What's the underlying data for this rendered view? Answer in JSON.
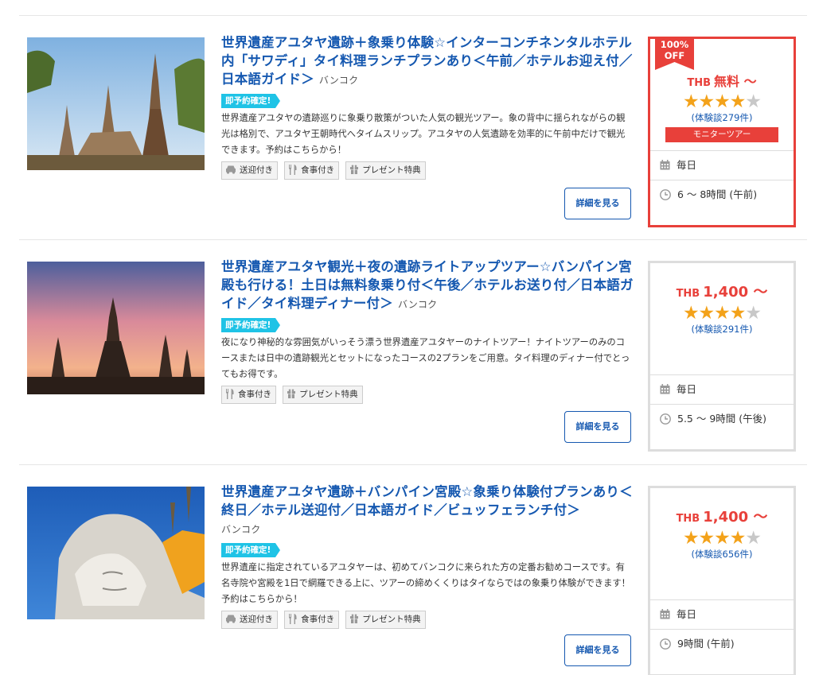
{
  "ui": {
    "detail_button_label": "詳細を見る"
  },
  "colors": {
    "link_blue": "#1558b0",
    "price_red": "#e8403a",
    "badge_cyan": "#1fc3e6",
    "star_orange": "#f3a21a"
  },
  "tours": [
    {
      "title": "世界遺産アユタヤ遺跡＋象乗り体験☆インターコンチネンタルホテル内「サワディ」タイ料理ランチプランあり＜午前／ホテルお迎え付／日本語ガイド＞",
      "city": "バンコク",
      "badge": "即予約確定!",
      "description": "世界遺産アユタヤの遺跡巡りに象乗り散策がついた人気の観光ツアー。象の背中に揺られながらの観光は格別で、アユタヤ王朝時代へタイムスリップ。アユタヤの人気遺跡を効率的に午前中だけで観光できます。予約はこちらから！",
      "features": [
        {
          "icon": "car-icon",
          "label": "送迎付き"
        },
        {
          "icon": "meal-icon",
          "label": "食事付き"
        },
        {
          "icon": "gift-icon",
          "label": "プレゼント特典"
        }
      ],
      "currency": "THB",
      "price": "無料",
      "price_suffix": "～",
      "rating": 4,
      "reviews": "(体験談279件)",
      "discount_line1": "100%",
      "discount_line2": "OFF",
      "monitor_label": "モニターツアー",
      "frequency": "毎日",
      "duration": "6 ～ 8時間 (午前)"
    },
    {
      "title": "世界遺産アユタヤ観光＋夜の遺跡ライトアップツアー☆バンパイン宮殿も行ける！土日は無料象乗り付＜午後／ホテルお送り付／日本語ガイド／タイ料理ディナー付＞",
      "city": "バンコク",
      "badge": "即予約確定!",
      "description": "夜になり神秘的な雰囲気がいっそう漂う世界遺産アユタヤーのナイトツアー！ナイトツアーのみのコースまたは日中の遺跡観光とセットになったコースの2プランをご用意。タイ料理のディナー付でとってもお得です。",
      "features": [
        {
          "icon": "meal-icon",
          "label": "食事付き"
        },
        {
          "icon": "gift-icon",
          "label": "プレゼント特典"
        }
      ],
      "currency": "THB",
      "price": "1,400",
      "price_suffix": "～",
      "rating": 4,
      "reviews": "(体験談291件)",
      "frequency": "毎日",
      "duration": "5.5 ～ 9時間 (午後)"
    },
    {
      "title": "世界遺産アユタヤ遺跡＋バンパイン宮殿☆象乗り体験付プランあり＜終日／ホテル送迎付／日本語ガイド／ビュッフェランチ付＞",
      "city": "バンコク",
      "badge": "即予約確定!",
      "description": "世界遺産に指定されているアユタヤーは、初めてバンコクに来られた方の定番お勧めコースです。有名寺院や宮殿を1日で網羅できる上に、ツアーの締めくくりはタイならではの象乗り体験ができます！予約はこちらから！",
      "features": [
        {
          "icon": "car-icon",
          "label": "送迎付き"
        },
        {
          "icon": "meal-icon",
          "label": "食事付き"
        },
        {
          "icon": "gift-icon",
          "label": "プレゼント特典"
        }
      ],
      "currency": "THB",
      "price": "1,400",
      "price_suffix": "～",
      "rating": 4,
      "reviews": "(体験談656件)",
      "frequency": "毎日",
      "duration": "9時間 (午前)"
    }
  ]
}
